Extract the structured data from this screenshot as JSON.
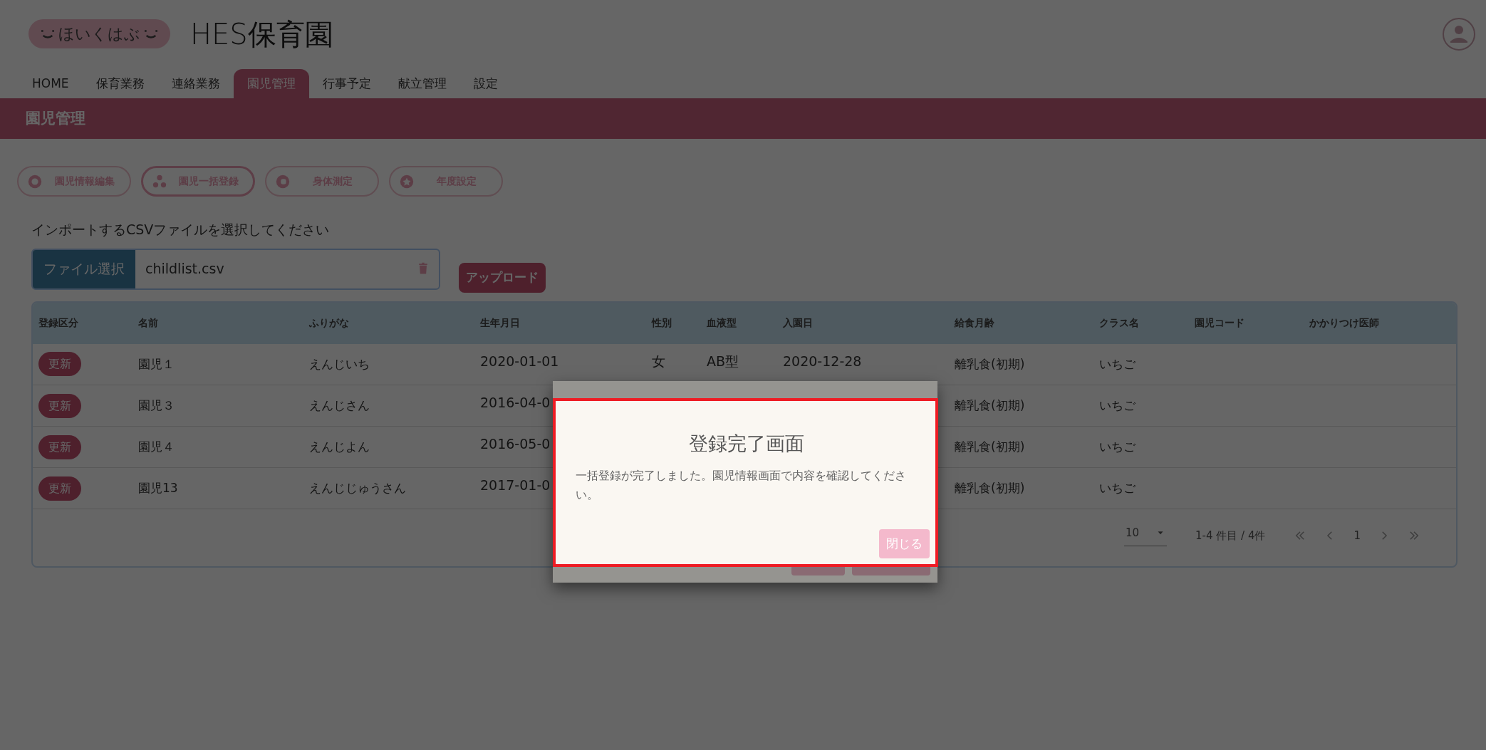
{
  "logo": {
    "text": "ほいくはぶ"
  },
  "title": "HES保育園",
  "nav": [
    {
      "label": "HOME",
      "selected": false
    },
    {
      "label": "保育業務",
      "selected": false
    },
    {
      "label": "連絡業務",
      "selected": false
    },
    {
      "label": "園児管理",
      "selected": true
    },
    {
      "label": "行事予定",
      "selected": false
    },
    {
      "label": "献立管理",
      "selected": false
    },
    {
      "label": "設定",
      "selected": false
    }
  ],
  "banner": {
    "title": "園児管理"
  },
  "actions": [
    {
      "label": "園児情報編集",
      "selected": false
    },
    {
      "label": "園児一括登録",
      "selected": true
    },
    {
      "label": "身体測定",
      "selected": false
    },
    {
      "label": "年度設定",
      "selected": false
    }
  ],
  "prompt": "インポートするCSVファイルを選択してください",
  "file": {
    "button": "ファイル選択",
    "value": "childlist.csv"
  },
  "upload": "アップロード",
  "table": {
    "columns": [
      "登録区分",
      "名前",
      "ふりがな",
      "生年月日",
      "性別",
      "血液型",
      "入園日",
      "給食月齢",
      "クラス名",
      "園児コード",
      "かかりつけ医師"
    ],
    "rows": [
      {
        "status": "更新",
        "name": "園児１",
        "furigana": "えんじいち",
        "birthdate": "2020-01-01",
        "sex": "女",
        "blood": "AB型",
        "entry": "2020-12-28",
        "meal": "離乳食(初期)",
        "class": "いちご"
      },
      {
        "status": "更新",
        "name": "園児３",
        "furigana": "えんじさん",
        "birthdate": "2016-04-0",
        "meal": "離乳食(初期)",
        "class": "いちご"
      },
      {
        "status": "更新",
        "name": "園児４",
        "furigana": "えんじよん",
        "birthdate": "2016-05-0",
        "meal": "離乳食(初期)",
        "class": "いちご"
      },
      {
        "status": "更新",
        "name": "園児13",
        "furigana": "えんじじゅうさん",
        "birthdate": "2017-01-0",
        "meal": "離乳食(初期)",
        "class": "いちご"
      }
    ]
  },
  "pagination": {
    "page_size": "10",
    "range": "1-4 件目 / 4件",
    "page": "1"
  },
  "modal": {
    "title": "登録完了画面",
    "message": "一括登録が完了しました。園児情報画面で内容を確認してください。",
    "button": "閉じる"
  }
}
